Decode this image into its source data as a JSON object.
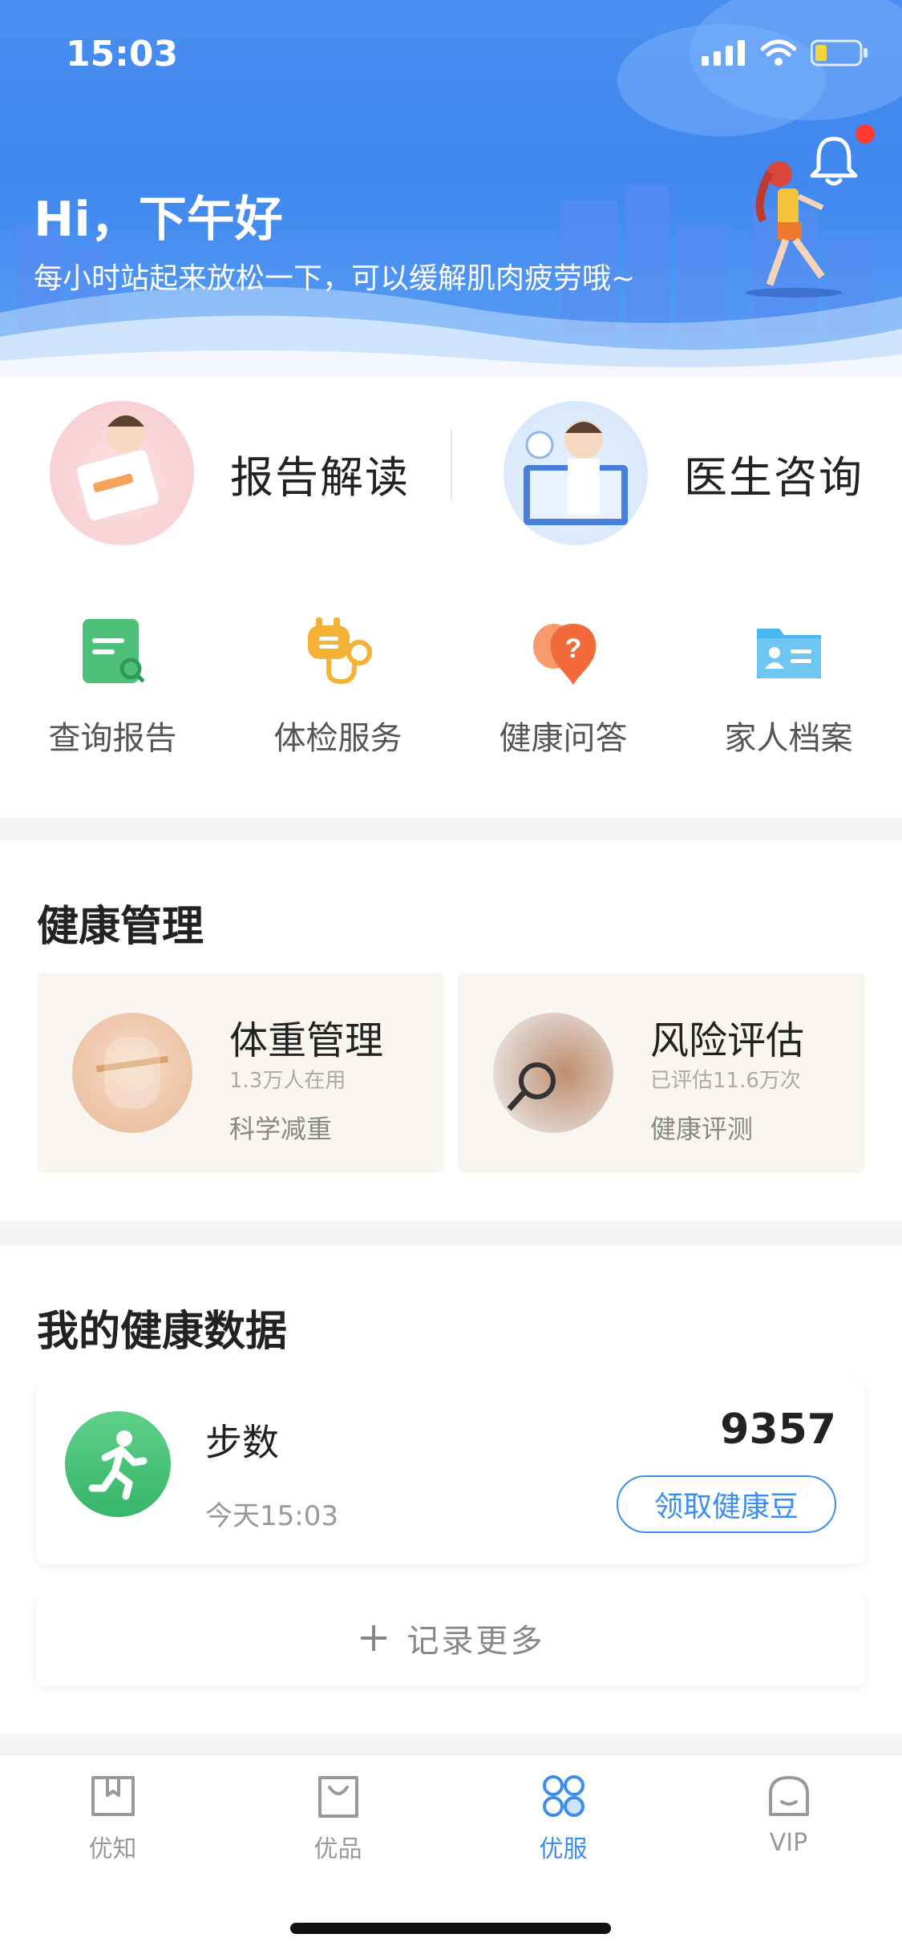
{
  "status_bar": {
    "time": "15:03"
  },
  "header": {
    "greeting": "Hi，下午好",
    "subtitle": "每小时站起来放松一下，可以缓解肌肉疲劳哦~"
  },
  "features": {
    "report_reading": "报告解读",
    "doctor_consult": "医生咨询"
  },
  "quick_actions": [
    {
      "label": "查询报告",
      "icon": "report-search-icon",
      "color": "#4dc17a"
    },
    {
      "label": "体检服务",
      "icon": "stethoscope-icon",
      "color": "#f5b234"
    },
    {
      "label": "健康问答",
      "icon": "question-bubble-icon",
      "color": "#f36a3a"
    },
    {
      "label": "家人档案",
      "icon": "family-folder-icon",
      "color": "#4ab6ef"
    }
  ],
  "health_management": {
    "title": "健康管理",
    "cards": [
      {
        "title": "体重管理",
        "stat": "1.3万人在用",
        "sub": "科学减重"
      },
      {
        "title": "风险评估",
        "stat": "已评估11.6万次",
        "sub": "健康评测"
      }
    ]
  },
  "health_data": {
    "title": "我的健康数据",
    "steps_label": "步数",
    "steps_value": "9357",
    "steps_time": "今天15:03",
    "claim_button": "领取健康豆",
    "record_more": "记录更多"
  },
  "tabs": [
    {
      "label": "优知",
      "icon": "book-icon",
      "active": false
    },
    {
      "label": "优品",
      "icon": "shopping-bag-icon",
      "active": false
    },
    {
      "label": "优服",
      "icon": "service-grid-icon",
      "active": true
    },
    {
      "label": "VIP",
      "icon": "vip-icon",
      "active": false
    }
  ],
  "colors": {
    "primary": "#3b8ef0",
    "header_bg": "#4a8ff0",
    "notification": "#ff3b30"
  }
}
